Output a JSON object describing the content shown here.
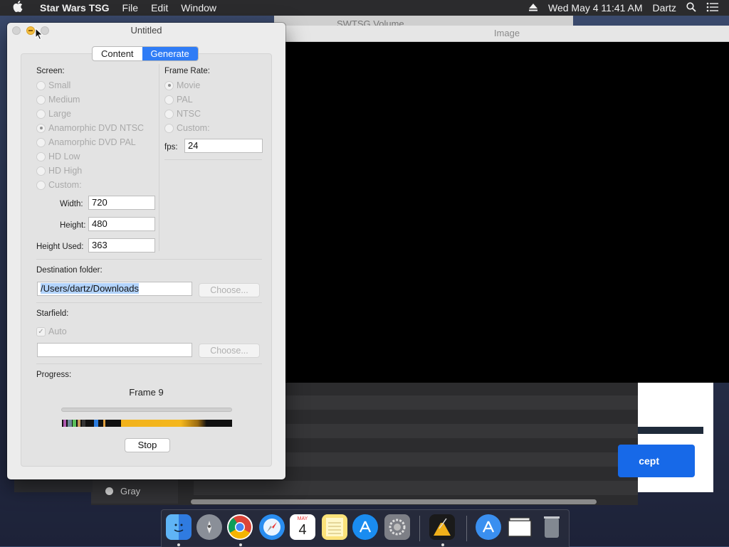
{
  "menubar": {
    "app_name": "Star Wars TSG",
    "menus": [
      "File",
      "Edit",
      "Window"
    ],
    "datetime": "Wed May 4  11:41 AM",
    "user": "Dartz"
  },
  "background": {
    "volume_window_title": "SWTSG Volume",
    "image_window_title": "Image",
    "sidebar_item": "Gray",
    "accept_label": "cept"
  },
  "dialog": {
    "title": "Untitled",
    "tabs": [
      {
        "label": "Content",
        "active": false
      },
      {
        "label": "Generate",
        "active": true
      }
    ],
    "screen": {
      "label": "Screen:",
      "options": [
        "Small",
        "Medium",
        "Large",
        "Anamorphic DVD NTSC",
        "Anamorphic DVD PAL",
        "HD Low",
        "HD High",
        "Custom:"
      ],
      "selected": "Anamorphic DVD NTSC"
    },
    "frame_rate": {
      "label": "Frame Rate:",
      "options": [
        "Movie",
        "PAL",
        "NTSC",
        "Custom:"
      ],
      "selected": "Movie",
      "fps_label": "fps:",
      "fps_value": "24"
    },
    "dimensions": {
      "width_label": "Width:",
      "width_value": "720",
      "height_label": "Height:",
      "height_value": "480",
      "height_used_label": "Height Used:",
      "height_used_value": "363"
    },
    "destination": {
      "label": "Destination folder:",
      "value": "/Users/dartz/Downloads",
      "choose_label": "Choose..."
    },
    "starfield": {
      "label": "Starfield:",
      "auto_label": "Auto",
      "auto_checked": true,
      "value": "",
      "choose_label": "Choose..."
    },
    "progress": {
      "label": "Progress:",
      "status": "Frame 9",
      "stop_label": "Stop"
    }
  },
  "dock": {
    "apps": [
      "finder-icon",
      "launchpad-icon",
      "chrome-icon",
      "safari-icon",
      "calendar-icon",
      "notes-icon",
      "app-store-icon",
      "system-preferences-icon",
      "star-wars-tsg-icon",
      "applications-folder-icon",
      "documents-folder-icon",
      "trash-icon"
    ],
    "calendar_month": "MAY",
    "calendar_day": "4"
  }
}
